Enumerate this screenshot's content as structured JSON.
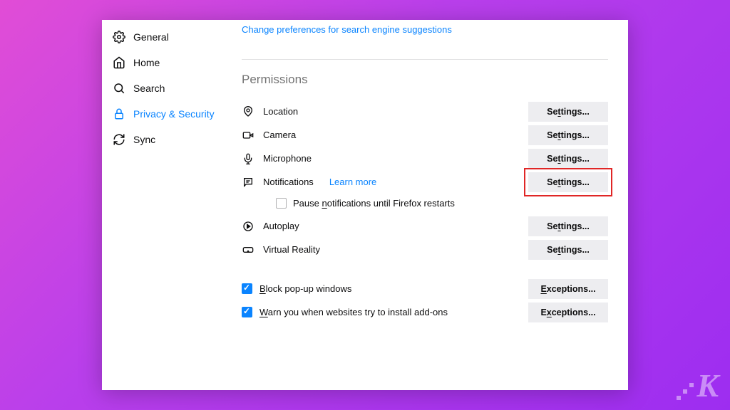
{
  "sidebar": {
    "items": [
      {
        "label": "General"
      },
      {
        "label": "Home"
      },
      {
        "label": "Search"
      },
      {
        "label": "Privacy & Security"
      },
      {
        "label": "Sync"
      }
    ]
  },
  "top_link": "Change preferences for search engine suggestions",
  "section_title": "Permissions",
  "permissions": {
    "location": {
      "label": "Location",
      "button": "Settings..."
    },
    "camera": {
      "label": "Camera",
      "button": "Settings..."
    },
    "microphone": {
      "label": "Microphone",
      "button": "Settings..."
    },
    "notifications": {
      "label": "Notifications",
      "learn_more": "Learn more",
      "button": "Settings..."
    },
    "pause_label": "Pause notifications until Firefox restarts",
    "autoplay": {
      "label": "Autoplay",
      "button": "Settings..."
    },
    "vr": {
      "label": "Virtual Reality",
      "button": "Settings..."
    },
    "popup": {
      "label": "Block pop-up windows",
      "button": "Exceptions..."
    },
    "addons": {
      "label": "Warn you when websites try to install add-ons",
      "button": "Exceptions..."
    }
  }
}
